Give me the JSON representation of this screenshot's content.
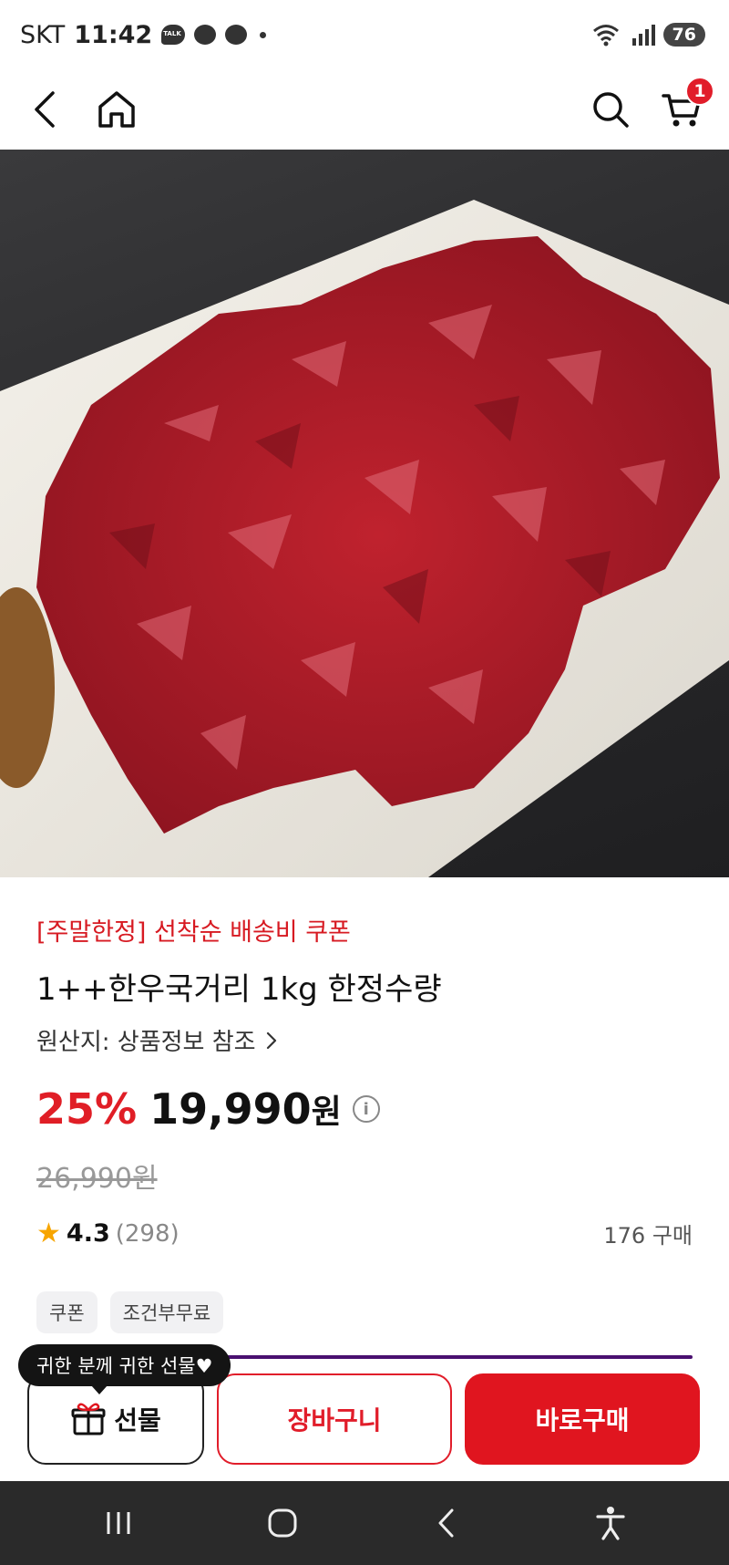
{
  "status_bar": {
    "carrier": "SKT",
    "time": "11:42",
    "battery": "76"
  },
  "header": {
    "icons": [
      "back-icon",
      "home-icon",
      "search-icon",
      "cart-icon"
    ],
    "cart_badge": "1"
  },
  "product": {
    "image_icon": "product-photo-beef-cubes",
    "promo": "[주말한정] 선착순 배송비 쿠폰",
    "title": "1++한우국거리 1kg 한정수량",
    "origin": "원산지: 상품정보 참조",
    "discount": "25%",
    "price": "19,990",
    "currency": "원",
    "original_price": "26,990원",
    "rating": "4.3",
    "review_count": "(298)",
    "purchase_count": "176 구매",
    "tags": [
      "쿠폰",
      "조건부무료"
    ]
  },
  "bottom_bar": {
    "gift_tooltip": "귀한 분께 귀한 선물♥",
    "gift_label": "선물",
    "cart_label": "장바구니",
    "buy_label": "바로구매"
  },
  "colors": {
    "accent": "#e0151f",
    "discount": "#e01e26",
    "promo": "#d71a22",
    "star": "#f7a500"
  }
}
